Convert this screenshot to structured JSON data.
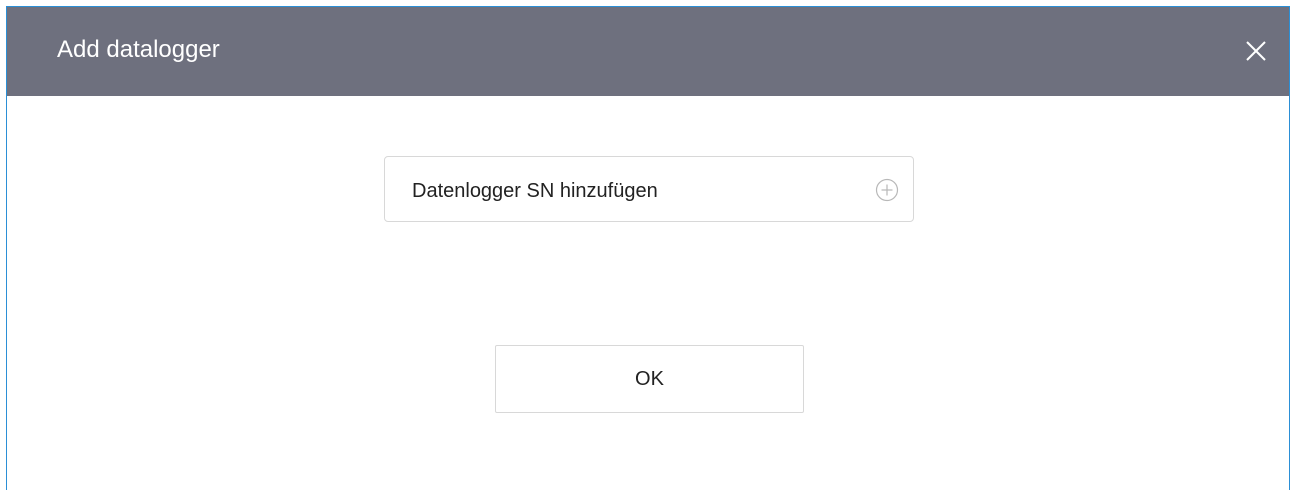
{
  "dialog": {
    "title": "Add datalogger",
    "close_icon": "close-icon"
  },
  "form": {
    "sn_field_label": "Datenlogger SN hinzufügen",
    "add_icon": "plus-circle-icon"
  },
  "actions": {
    "ok_label": "OK"
  },
  "colors": {
    "header_bg": "#6e707e",
    "dialog_border": "#2b8fd6",
    "field_border": "#d8d8d8",
    "text": "#222222",
    "title_text": "#ffffff"
  }
}
